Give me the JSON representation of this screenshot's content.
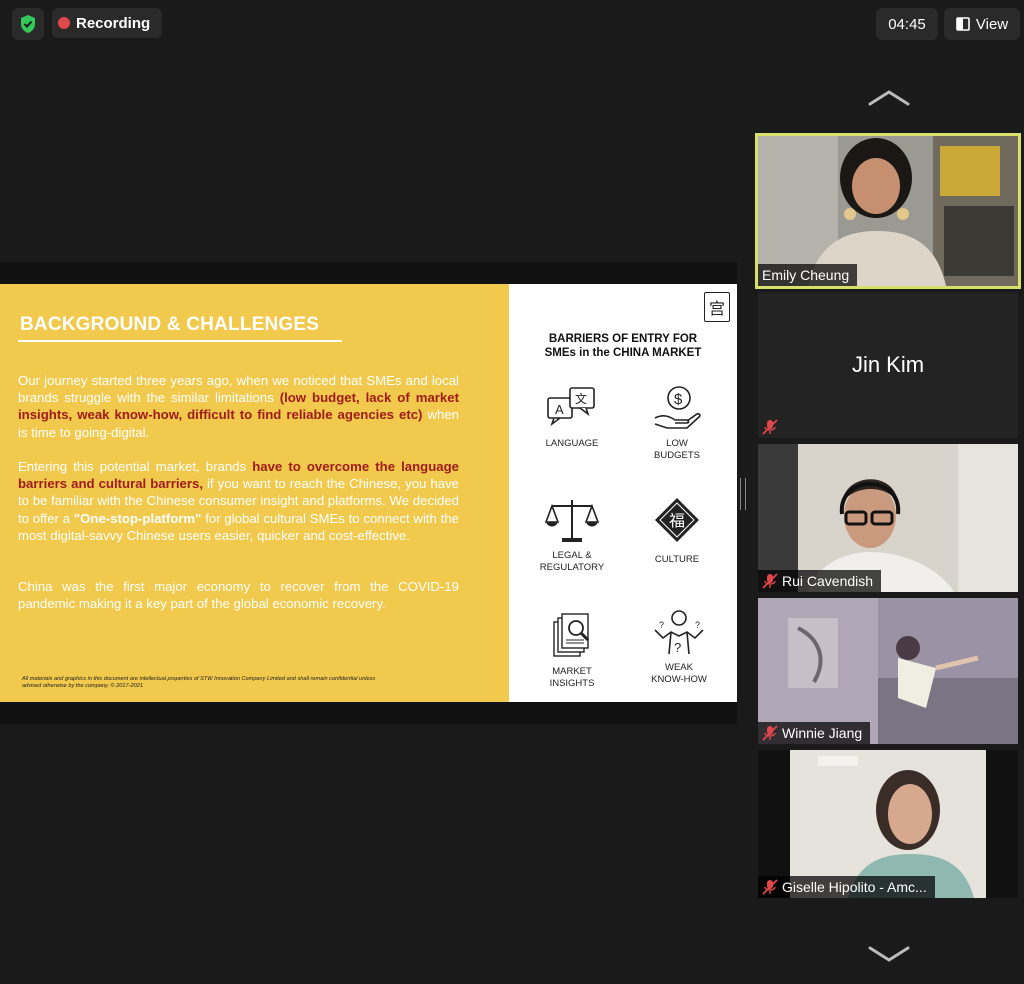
{
  "topbar": {
    "recording_label": "Recording",
    "timer": "04:45",
    "view_label": "View"
  },
  "slide": {
    "title": "BACKGROUND & CHALLENGES",
    "p1": {
      "a": "Our journey started three years ago, when we noticed that SMEs and local brands struggle with the similar limitations ",
      "b": "(low budget, lack of market insights, weak know-how, difficult to find reliable agencies etc)",
      "c": " when is time to going-digital."
    },
    "p2": {
      "a": "Entering this potential market, brands ",
      "b": "have to overcome the language barriers and cultural barriers,",
      "c": " if you want to reach the Chinese, you have to be familiar with the Chinese consumer insight and platforms. We decided to offer a ",
      "d": " \"One-stop-platform\"",
      "e": " for global cultural SMEs to connect with the most digital-savvy Chinese users easier, quicker and cost-effective."
    },
    "p3": "China was the first major economy to recover from the COVID-19 pandemic making it a key part of the global economic recovery.",
    "footer": "All materials and graphics in this document are intellectual properties of STW Innovation Company Limited and shall remain confidential unless advised otherwise by the company. © 2017-2021",
    "logo_char": "宫",
    "barriers_title_1": "BARRIERS OF ENTRY FOR",
    "barriers_title_2": "SMEs in the CHINA MARKET",
    "barriers": [
      {
        "icon": "language-icon",
        "label_1": "LANGUAGE",
        "label_2": ""
      },
      {
        "icon": "budget-icon",
        "label_1": "LOW",
        "label_2": "BUDGETS"
      },
      {
        "icon": "scales-icon",
        "label_1": "LEGAL &",
        "label_2": "REGULATORY"
      },
      {
        "icon": "fu-culture-icon",
        "label_1": "CULTURE",
        "label_2": ""
      },
      {
        "icon": "market-insights-icon",
        "label_1": "MARKET",
        "label_2": "INSIGHTS"
      },
      {
        "icon": "confused-person-icon",
        "label_1": "WEAK",
        "label_2": "KNOW-HOW"
      }
    ]
  },
  "participants": [
    {
      "name": "Emily Cheung",
      "muted": false,
      "active": true,
      "video": true
    },
    {
      "name": "Jin Kim",
      "muted": true,
      "active": false,
      "video": false
    },
    {
      "name": "Rui Cavendish",
      "muted": true,
      "active": false,
      "video": true
    },
    {
      "name": "Winnie Jiang",
      "muted": true,
      "active": false,
      "video": true
    },
    {
      "name": "Giselle Hipolito - Amc...",
      "muted": true,
      "active": false,
      "video": true
    }
  ],
  "colors": {
    "slide_yellow": "#f1c94c",
    "highlight_red": "#a01c1c",
    "active_speaker": "#d8e06a",
    "record_red": "#e0474a",
    "shield_green": "#34c759"
  }
}
